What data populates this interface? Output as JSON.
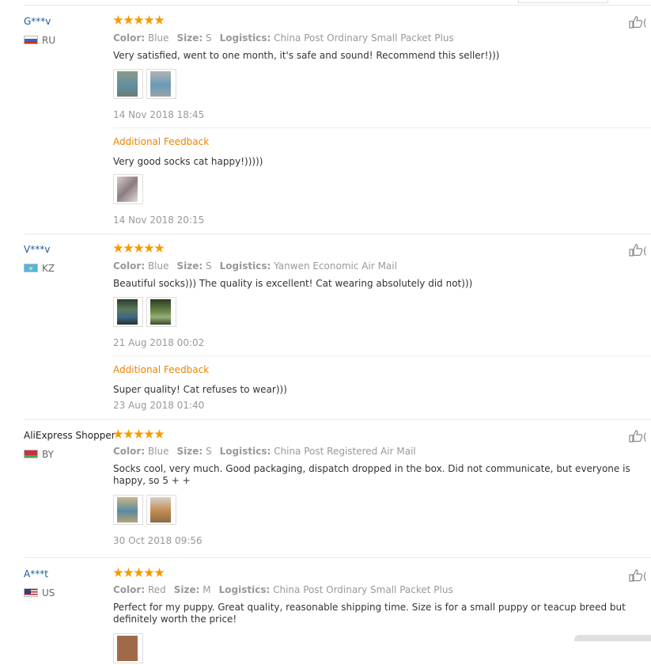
{
  "reviews": [
    {
      "user": "G***v",
      "country": "RU",
      "flag": "ru",
      "color_label": "Color:",
      "color": "Blue",
      "size_label": "Size:",
      "size": "S",
      "logistics_label": "Logistics:",
      "logistics": "China Post Ordinary Small Packet Plus",
      "text": "Very satisfied, went to one month, it's safe and sound! Recommend this seller!)))",
      "date": "14 Nov 2018 18:45",
      "additional": {
        "label": "Additional Feedback",
        "text": "Very good socks cat happy!)))))",
        "date": "14 Nov 2018 20:15"
      },
      "like_count": "(",
      "thumb_colors": [
        "#7fa3a8",
        "#9bb4c2"
      ]
    },
    {
      "user": "V***v",
      "country": "KZ",
      "flag": "kz",
      "color_label": "Color:",
      "color": "Blue",
      "size_label": "Size:",
      "size": "S",
      "logistics_label": "Logistics:",
      "logistics": "Yanwen Economic Air Mail",
      "text": "Beautiful socks))) The quality is excellent! Cat wearing absolutely did not)))",
      "date": "21 Aug 2018 00:02",
      "additional": {
        "label": "Additional Feedback",
        "text": "Super quality! Cat refuses to wear)))",
        "date": "23 Aug 2018 01:40"
      },
      "like_count": "(",
      "thumb_colors": [
        "#3a4a3c",
        "#4d6b3a"
      ]
    },
    {
      "user": "AliExpress Shopper",
      "country": "BY",
      "flag": "by",
      "color_label": "Color:",
      "color": "Blue",
      "size_label": "Size:",
      "size": "S",
      "logistics_label": "Logistics:",
      "logistics": "China Post Registered Air Mail",
      "text": "Socks cool, very much. Good packaging, dispatch dropped in the box. Did not communicate, but everyone is happy, so 5 + +",
      "date": "30 Oct 2018 09:56",
      "like_count": "(",
      "thumb_colors": [
        "#b09a6a",
        "#c08a5a"
      ]
    },
    {
      "user": "A***t",
      "country": "US",
      "flag": "us",
      "color_label": "Color:",
      "color": "Red",
      "size_label": "Size:",
      "size": "M",
      "logistics_label": "Logistics:",
      "logistics": "China Post Ordinary Small Packet Plus",
      "text": "Perfect for my puppy. Great quality, reasonable shipping time. Size is for a small puppy or teacup breed but definitely worth the price!",
      "like_count": "(",
      "thumb_colors": [
        "#a06a4a"
      ]
    }
  ],
  "icons": {
    "like": "thumbs-up-icon",
    "star": "star-icon"
  },
  "colors": {
    "username": "#1a5c9a",
    "stars": "#f69a00",
    "additional": "#f08200",
    "meta": "#999999"
  }
}
